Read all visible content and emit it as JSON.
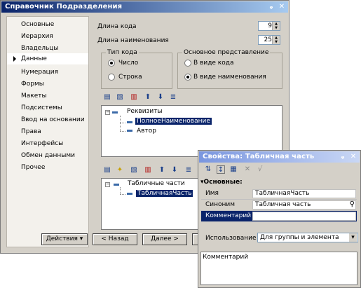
{
  "main_window": {
    "title": "Справочник Подразделения",
    "nav_items": [
      {
        "label": "Основные",
        "selected": false
      },
      {
        "label": "Иерархия",
        "selected": false
      },
      {
        "label": "Владельцы",
        "selected": false
      },
      {
        "label": "Данные",
        "selected": true
      },
      {
        "label": "Нумерация",
        "selected": false
      },
      {
        "label": "Формы",
        "selected": false
      },
      {
        "label": "Макеты",
        "selected": false
      },
      {
        "label": "Подсистемы",
        "selected": false
      },
      {
        "label": "Ввод на основании",
        "selected": false
      },
      {
        "label": "Права",
        "selected": false
      },
      {
        "label": "Интерфейсы",
        "selected": false
      },
      {
        "label": "Обмен данными",
        "selected": false
      },
      {
        "label": "Прочее",
        "selected": false
      }
    ],
    "code_length_label": "Длина кода",
    "code_length_value": "9",
    "name_length_label": "Длина наименования",
    "name_length_value": "25",
    "code_type": {
      "title": "Тип кода",
      "options": [
        "Число",
        "Строка"
      ],
      "selected": "Число"
    },
    "main_view": {
      "title": "Основное представление",
      "options": [
        "В виде кода",
        "В виде наименования"
      ],
      "selected": "В виде наименования"
    },
    "attributes_tree": {
      "root": "Реквизиты",
      "children": [
        "ПолноеНаименование",
        "Автор"
      ],
      "selected": "ПолноеНаименование"
    },
    "tabular_tree": {
      "root": "Табличные части",
      "children": [
        "ТабличнаяЧасть"
      ],
      "selected": "ТабличнаяЧасть"
    },
    "buttons": {
      "actions": "Действия",
      "back": "< Назад",
      "next": "Далее >"
    }
  },
  "props_window": {
    "title": "Свойства: Табличная часть",
    "section": "Основные:",
    "rows": [
      {
        "name": "Имя",
        "value": "ТабличнаяЧасть"
      },
      {
        "name": "Синоним",
        "value": "Табличная часть"
      },
      {
        "name": "Комментарий",
        "value": ""
      }
    ],
    "usage_label": "Использование",
    "usage_value": "Для группы и элемента",
    "comment_area": "Комментарий"
  }
}
